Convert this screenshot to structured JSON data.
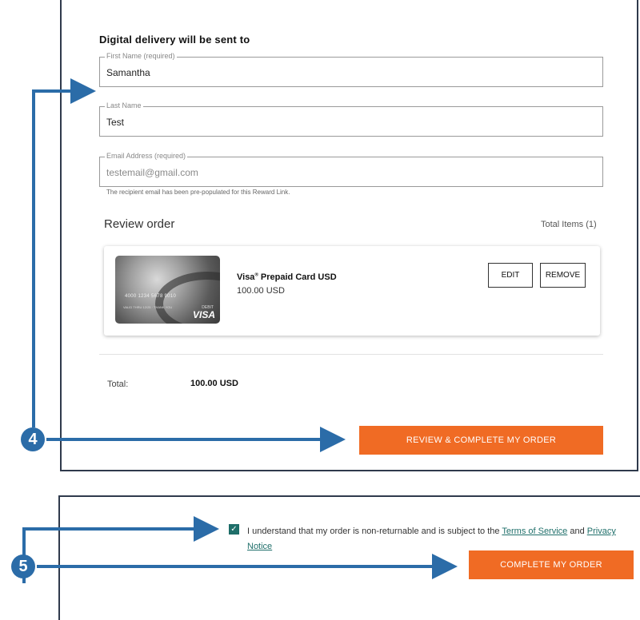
{
  "form": {
    "heading": "Digital delivery will be sent to",
    "first_name": {
      "label": "First Name (required)",
      "value": "Samantha"
    },
    "last_name": {
      "label": "Last Name",
      "value": "Test"
    },
    "email": {
      "label": "Email Address (required)",
      "value": "testemail@gmail.com"
    },
    "email_hint": "The recipient email has been pre-populated for this Reward Link."
  },
  "review": {
    "title": "Review order",
    "total_items": "Total Items (1)",
    "item": {
      "name": "Visa",
      "name_sup": "®",
      "name_rest": " Prepaid Card USD",
      "price": "100.00 USD",
      "card_number": "4000 1234 5678 9010",
      "card_small_text": "VALID THRU 12/25 · THANK YOU",
      "card_debit": "DEBIT",
      "card_brand": "VISA",
      "edit_label": "EDIT",
      "remove_label": "REMOVE"
    },
    "total_label": "Total:",
    "total_value": "100.00 USD",
    "review_button": "REVIEW & COMPLETE MY ORDER"
  },
  "confirm": {
    "agree_text": "I understand that my order is non-returnable and is subject to the ",
    "terms_link": "Terms of Service",
    "and_text": " and ",
    "privacy_link": "Privacy Notice",
    "checked": true,
    "complete_button": "COMPLETE MY ORDER"
  },
  "steps": {
    "step4": "4",
    "step5": "5"
  },
  "colors": {
    "accent": "#f06b24",
    "step": "#2b6ca8",
    "check": "#1f6f6a"
  }
}
